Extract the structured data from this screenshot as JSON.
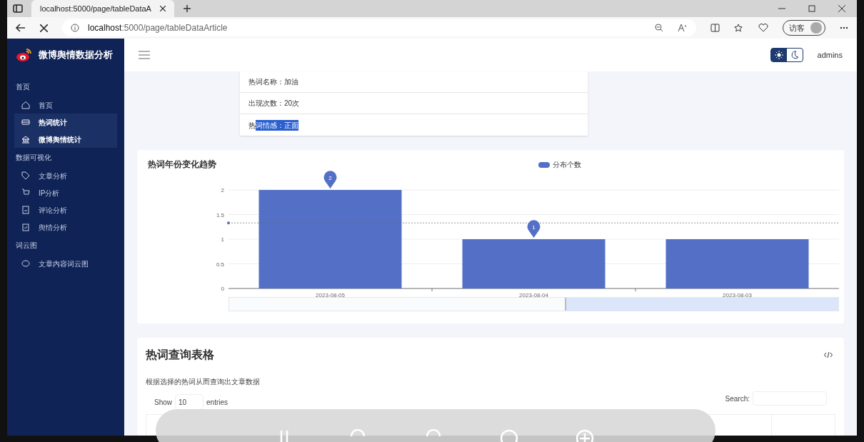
{
  "browser": {
    "tab_title": "localhost:5000/page/tableDataA",
    "url_host": "localhost",
    "url_rest": ":5000/page/tableDataArticle",
    "profile_label": "访客"
  },
  "sidebar": {
    "brand": "微博舆情数据分析",
    "sections": [
      {
        "title": "首页",
        "items": [
          {
            "label": "首页",
            "selected": false
          },
          {
            "label": "热词统计",
            "selected": true
          },
          {
            "label": "微博舆情统计",
            "selected": true
          }
        ]
      },
      {
        "title": "数据可视化",
        "items": [
          {
            "label": "文章分析",
            "selected": false
          },
          {
            "label": "IP分析",
            "selected": false
          },
          {
            "label": "评论分析",
            "selected": false
          },
          {
            "label": "舆情分析",
            "selected": false
          }
        ]
      },
      {
        "title": "词云图",
        "items": [
          {
            "label": "文章内容词云图",
            "selected": false
          }
        ]
      }
    ]
  },
  "header": {
    "theme_toggle": [
      {
        "selected": true
      },
      {
        "selected": false
      }
    ],
    "user": "admins"
  },
  "info": [
    {
      "text": "热词名称：加油"
    },
    {
      "text": "出现次数：20次"
    },
    {
      "text": "热",
      "highlight": "词情感：正面"
    }
  ],
  "chart": {
    "title": "热词年份变化趋势",
    "chart_data": {
      "type": "bar",
      "categories": [
        "2023-08-05",
        "2023-08-04",
        "2023-08-03"
      ],
      "series": [
        {
          "name": "分布个数",
          "color": "#5470c6",
          "values": [
            2,
            1,
            1
          ]
        }
      ],
      "ylim": [
        0,
        2
      ],
      "yticks": [
        0,
        0.5,
        1,
        1.5,
        2
      ],
      "grid": true,
      "annotations": [
        {
          "text": "2",
          "x": "2023-08-05",
          "y": 2
        },
        {
          "text": "1",
          "x": "2023-08-04",
          "y": 1
        }
      ],
      "ref_lines": [
        {
          "axis": "y",
          "value": 1.33
        }
      ]
    }
  },
  "table_card": {
    "title": "热词查询表格",
    "description": "根据选择的热词从而查询出文章数据",
    "show_label": "Show",
    "page_size": "10",
    "entries_label": "entries",
    "search_label": "Search:"
  }
}
